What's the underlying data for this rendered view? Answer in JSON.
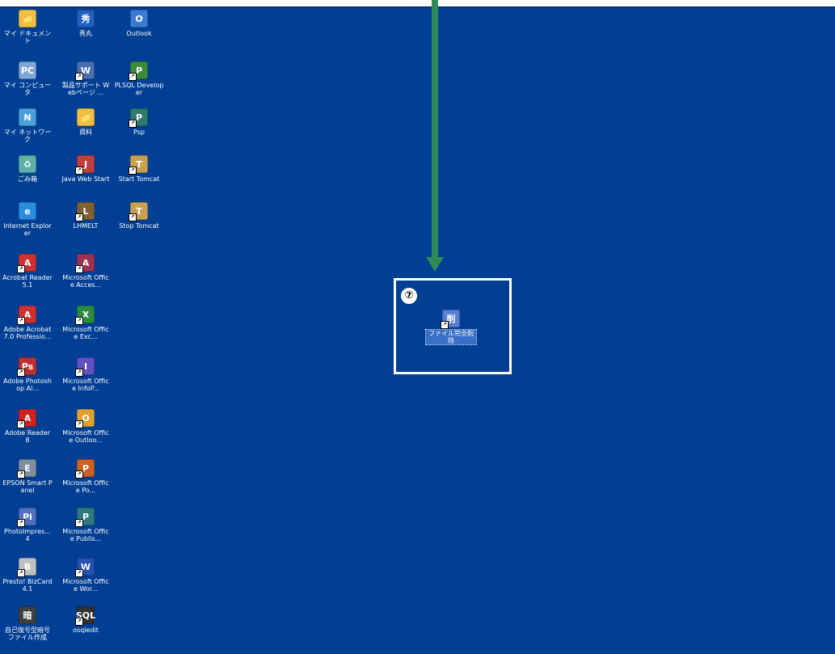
{
  "desktop": {
    "icons": [
      {
        "label": "マイ ドキュメント",
        "icon": "my-documents-icon",
        "color": "#f0c040",
        "glyph": "📁",
        "shortcut": false
      },
      {
        "label": "秀丸",
        "icon": "hidemaru-icon",
        "color": "#2060c0",
        "glyph": "秀",
        "shortcut": false
      },
      {
        "label": "Outlook",
        "icon": "outlook-icon",
        "color": "#3a7bd5",
        "glyph": "O",
        "shortcut": false
      },
      {
        "label": "マイ コンピュータ",
        "icon": "my-computer-icon",
        "color": "#7fa7d8",
        "glyph": "PC",
        "shortcut": false
      },
      {
        "label": "製品サポート Webページ ...",
        "icon": "product-support-icon",
        "color": "#4a6fb0",
        "glyph": "W",
        "shortcut": true
      },
      {
        "label": "PLSQL Developer",
        "icon": "plsql-developer-icon",
        "color": "#3c8a3c",
        "glyph": "P",
        "shortcut": true
      },
      {
        "label": "マイ ネットワーク",
        "icon": "my-network-icon",
        "color": "#4aa0d8",
        "glyph": "N",
        "shortcut": false
      },
      {
        "label": "資料",
        "icon": "folder-icon",
        "color": "#f0c040",
        "glyph": "📁",
        "shortcut": false
      },
      {
        "label": "Psp",
        "icon": "psp-icon",
        "color": "#2f7a6a",
        "glyph": "P",
        "shortcut": true
      },
      {
        "label": "ごみ箱",
        "icon": "recycle-bin-icon",
        "color": "#5fb0a8",
        "glyph": "♻",
        "shortcut": false
      },
      {
        "label": "Java Web Start",
        "icon": "java-web-start-icon",
        "color": "#c04040",
        "glyph": "J",
        "shortcut": true
      },
      {
        "label": "Start Tomcat",
        "icon": "tomcat-icon",
        "color": "#c8a050",
        "glyph": "T",
        "shortcut": true
      },
      {
        "label": "Internet Explorer",
        "icon": "internet-explorer-icon",
        "color": "#2a8ee0",
        "glyph": "e",
        "shortcut": false
      },
      {
        "label": "LHMELT",
        "icon": "lhmelt-icon",
        "color": "#806030",
        "glyph": "L",
        "shortcut": true
      },
      {
        "label": "Stop Tomcat",
        "icon": "tomcat-icon",
        "color": "#c8a050",
        "glyph": "T",
        "shortcut": true
      },
      {
        "label": "Acrobat Reader 5.1",
        "icon": "acrobat-reader-icon",
        "color": "#d03030",
        "glyph": "A",
        "shortcut": true
      },
      {
        "label": "Microsoft Office Acces...",
        "icon": "ms-access-icon",
        "color": "#a03050",
        "glyph": "A",
        "shortcut": true
      },
      {
        "label": "Adobe Acrobat 7.0 Professio...",
        "icon": "adobe-acrobat-icon",
        "color": "#d03030",
        "glyph": "A",
        "shortcut": true
      },
      {
        "label": "Microsoft Office Exc...",
        "icon": "ms-excel-icon",
        "color": "#2a8a40",
        "glyph": "X",
        "shortcut": true
      },
      {
        "label": "Adobe Photoshop Al...",
        "icon": "photoshop-album-icon",
        "color": "#c03030",
        "glyph": "Ps",
        "shortcut": true
      },
      {
        "label": "Microsoft Office InfoP...",
        "icon": "ms-infopath-icon",
        "color": "#6050c0",
        "glyph": "I",
        "shortcut": true
      },
      {
        "label": "Adobe Reader 8",
        "icon": "adobe-reader-icon",
        "color": "#d02020",
        "glyph": "A",
        "shortcut": true
      },
      {
        "label": "Microsoft Office Outloo...",
        "icon": "ms-outlook-icon",
        "color": "#e0a030",
        "glyph": "O",
        "shortcut": true
      },
      {
        "label": "EPSON Smart Panel",
        "icon": "epson-smart-panel-icon",
        "color": "#8090a0",
        "glyph": "E",
        "shortcut": true
      },
      {
        "label": "Microsoft Office Po...",
        "icon": "ms-powerpoint-icon",
        "color": "#d06020",
        "glyph": "P",
        "shortcut": true
      },
      {
        "label": "PhotoImpres... 4",
        "icon": "photoimpression-icon",
        "color": "#5070c0",
        "glyph": "Pi",
        "shortcut": true
      },
      {
        "label": "Microsoft Office Publis...",
        "icon": "ms-publisher-icon",
        "color": "#2a7a80",
        "glyph": "P",
        "shortcut": true
      },
      {
        "label": "Presto! BizCard 4.1",
        "icon": "presto-bizcard-icon",
        "color": "#c0c0c0",
        "glyph": "B",
        "shortcut": true
      },
      {
        "label": "Microsoft Office Wor...",
        "icon": "ms-word-icon",
        "color": "#2a50b0",
        "glyph": "W",
        "shortcut": true
      },
      {
        "label": "自己復号型暗号ファイル作成",
        "icon": "self-decrypt-file-icon",
        "color": "#404040",
        "glyph": "暗",
        "shortcut": false
      },
      {
        "label": "osqledit",
        "icon": "osqledit-icon",
        "color": "#303030",
        "glyph": "SQL",
        "shortcut": true
      }
    ]
  },
  "annotation": {
    "step_marker": "⑦",
    "arrow_color": "#2e8b57",
    "highlight_color": "#ffffff"
  },
  "target": {
    "label": "ファイル完全削除",
    "icon": "file-shredder-icon",
    "color": "#5a7fd0",
    "glyph": "削",
    "shortcut": true
  }
}
